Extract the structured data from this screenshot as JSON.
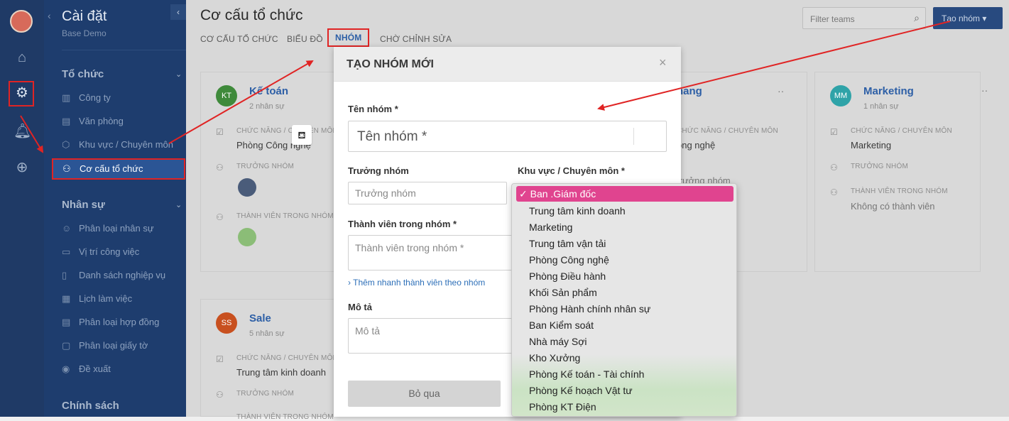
{
  "sidebar": {
    "title": "Cài đặt",
    "subtitle": "Base Demo",
    "sections": [
      {
        "label": "Tổ chức",
        "items": [
          "Công ty",
          "Văn phòng",
          "Khu vực / Chuyên môn",
          "Cơ cấu tổ chức"
        ]
      },
      {
        "label": "Nhân sự",
        "items": [
          "Phân loại nhân sự",
          "Vị trí công việc",
          "Danh sách nghiệp vụ",
          "Lịch làm việc",
          "Phân loại hợp đồng",
          "Phân loại giấy tờ",
          "Đề xuất"
        ]
      },
      {
        "label": "Chính sách"
      }
    ]
  },
  "page": {
    "title": "Cơ cấu tổ chức",
    "tabs": [
      "CƠ CẤU TỔ CHỨC",
      "BIỂU ĐỒ",
      "NHÓM",
      "CHỜ CHỈNH SỬA"
    ],
    "active_tab": "NHÓM",
    "filter_placeholder": "Filter teams",
    "add_button": "Tạo nhóm"
  },
  "cards": [
    {
      "initials": "KT",
      "name": "Kế toán",
      "count": "2 nhân sự",
      "function_label": "CHỨC NĂNG / CHUYÊN MÔN",
      "function_value": "Phòng Công nghệ",
      "leader_label": "TRƯỞNG NHÓM",
      "members_label": "THÀNH VIÊN TRONG NHÓM",
      "color": "#3f8a3b"
    },
    {
      "initials": "",
      "name": "hang",
      "count": "",
      "function_label": "CHỨC NĂNG / CHUYÊN MÔN",
      "function_value": "ông nghệ",
      "leader_label": "",
      "leader_value": "trưởng nhóm",
      "color": "#888888"
    },
    {
      "initials": "MM",
      "name": "Marketing",
      "count": "1 nhân sự",
      "function_label": "CHỨC NĂNG / CHUYÊN MÔN",
      "function_value": "Marketing",
      "leader_label": "TRƯỞNG NHÓM",
      "members_label": "THÀNH VIÊN TRONG NHÓM",
      "members_value": "Không có thành viên",
      "color": "#2fa3a8"
    },
    {
      "initials": "SS",
      "name": "Sale",
      "count": "5 nhân sự",
      "function_label": "CHỨC NĂNG / CHUYÊN MÔN",
      "function_value": "Trung tâm kinh doanh",
      "leader_label": "TRƯỞNG NHÓM",
      "members_label": "THÀNH VIÊN TRONG NHÓM",
      "color": "#c8501f"
    }
  ],
  "modal": {
    "title": "TẠO NHÓM MỚI",
    "name_label": "Tên nhóm *",
    "name_placeholder": "Tên nhóm *",
    "leader_label": "Trưởng nhóm",
    "leader_placeholder": "Trưởng nhóm",
    "area_label": "Khu vực / Chuyên môn *",
    "members_label": "Thành viên trong nhóm *",
    "members_placeholder": "Thành viên trong nhóm *",
    "quick_add": "› Thêm nhanh thành viên theo nhóm",
    "desc_label": "Mô tả",
    "desc_placeholder": "Mô tả",
    "skip_button": "Bỏ qua"
  },
  "dropdown": {
    "selected": "✓ Ban .Giám đốc",
    "options": [
      "Trung tâm kinh doanh",
      "Marketing",
      "Trung tâm vận tải",
      "Phòng Công nghệ",
      "Phòng Điều hành",
      "Khối Sản phẩm",
      "Phòng Hành chính nhân sự",
      "Ban Kiểm soát",
      "Nhà máy Sợi",
      "Kho Xưởng",
      "Phòng Kế toán - Tài chính",
      "Phòng Kế hoạch Vật tư",
      "Phòng KT Điện"
    ]
  },
  "colors": {
    "highlight": "#e02424",
    "accent": "#2d5fa6",
    "selected_option": "#e0448f"
  }
}
